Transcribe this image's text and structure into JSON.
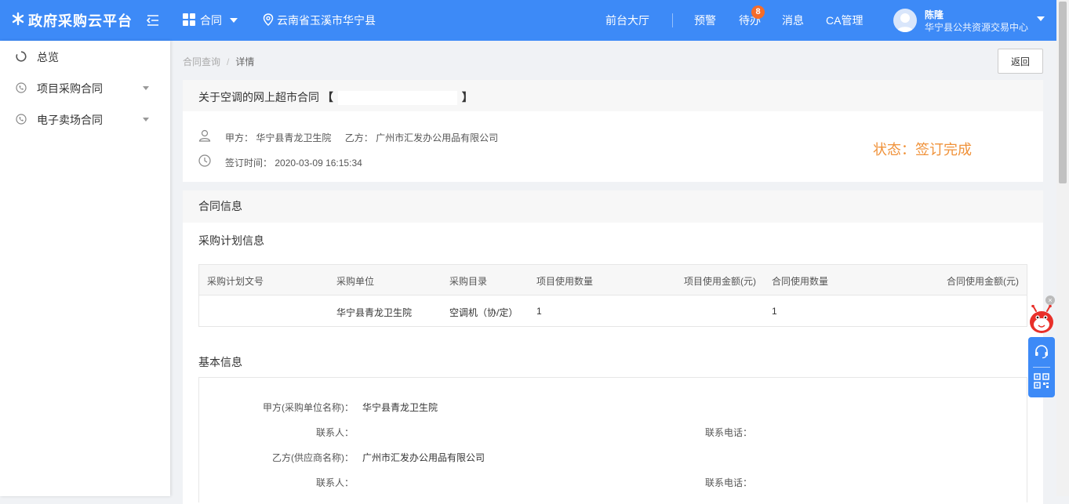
{
  "header": {
    "logo_text": "政府采购云平台",
    "module_label": "合同",
    "region": "云南省玉溪市华宁县",
    "nav": {
      "hall": "前台大厅",
      "alert": "预警",
      "todo": "待办",
      "todo_count": "8",
      "message": "消息",
      "ca": "CA管理"
    },
    "user": {
      "name": "陈隆",
      "org": "华宁县公共资源交易中心"
    }
  },
  "sidebar": {
    "items": [
      {
        "label": "总览"
      },
      {
        "label": "项目采购合同"
      },
      {
        "label": "电子卖场合同"
      }
    ]
  },
  "breadcrumb": {
    "parent": "合同查询",
    "separator": "/",
    "current": "详情"
  },
  "back_button": "返回",
  "contract": {
    "title": "关于空调的网上超市合同",
    "title_bracket_open": "【",
    "title_bracket_close": "】",
    "party_a_label": "甲方：",
    "party_a": "华宁县青龙卫生院",
    "party_b_label": "乙方：",
    "party_b": "广州市汇发办公用品有限公司",
    "sign_time_label": "签订时间：",
    "sign_time": "2020-03-09 16:15:34",
    "status": "状态：签订完成"
  },
  "info": {
    "title": "合同信息",
    "plan_title": "采购计划信息",
    "table": {
      "headers": [
        "采购计划文号",
        "采购单位",
        "采购目录",
        "项目使用数量",
        "项目使用金额(元)",
        "合同使用数量",
        "合同使用金额(元)"
      ],
      "rows": [
        [
          "",
          "华宁县青龙卫生院",
          "空调机（协/定）",
          "1",
          "",
          "1",
          ""
        ]
      ]
    },
    "basic_title": "基本信息",
    "basic": {
      "party_a_name_label": "甲方(采购单位名称)：",
      "party_a_name": "华宁县青龙卫生院",
      "contact_label": "联系人：",
      "phone_label": "联系电话：",
      "party_b_name_label": "乙方(供应商名称)：",
      "party_b_name": "广州市汇发办公用品有限公司",
      "contact_b_label": "联系人：",
      "phone_b_label": "联系电话："
    }
  },
  "float_widget": {
    "close_glyph": "×"
  },
  "colors": {
    "header_bg": "#3d8af7",
    "status": "#f0923a",
    "badge": "#f56c2a"
  }
}
